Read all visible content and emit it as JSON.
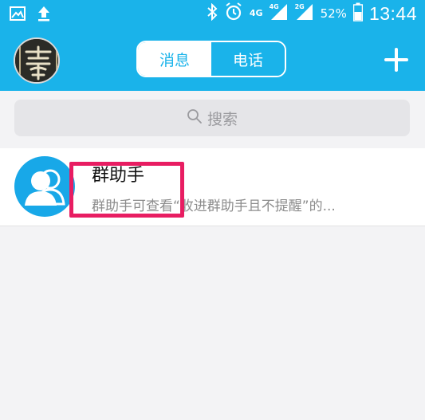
{
  "status_bar": {
    "icons": [
      "gallery-icon",
      "upload-icon",
      "bluetooth-icon",
      "alarm-icon",
      "signal-icon",
      "battery-icon"
    ],
    "net_primary": "4G",
    "net_sim1": "4G",
    "net_sim2": "2G",
    "battery": "52%",
    "time": "13:44"
  },
  "header": {
    "avatar_glyph": "善",
    "tabs": [
      {
        "label": "消息",
        "active": true
      },
      {
        "label": "电话",
        "active": false
      }
    ],
    "add_icon": "plus-icon"
  },
  "search": {
    "placeholder": "搜索",
    "icon": "search-icon"
  },
  "conversations": [
    {
      "title": "群助手",
      "preview": "群助手可查看“收进群助手且不提醒”的...",
      "avatar_icon": "group-people-icon"
    }
  ],
  "colors": {
    "primary": "#1ab3ea",
    "highlight": "#e81d62"
  }
}
